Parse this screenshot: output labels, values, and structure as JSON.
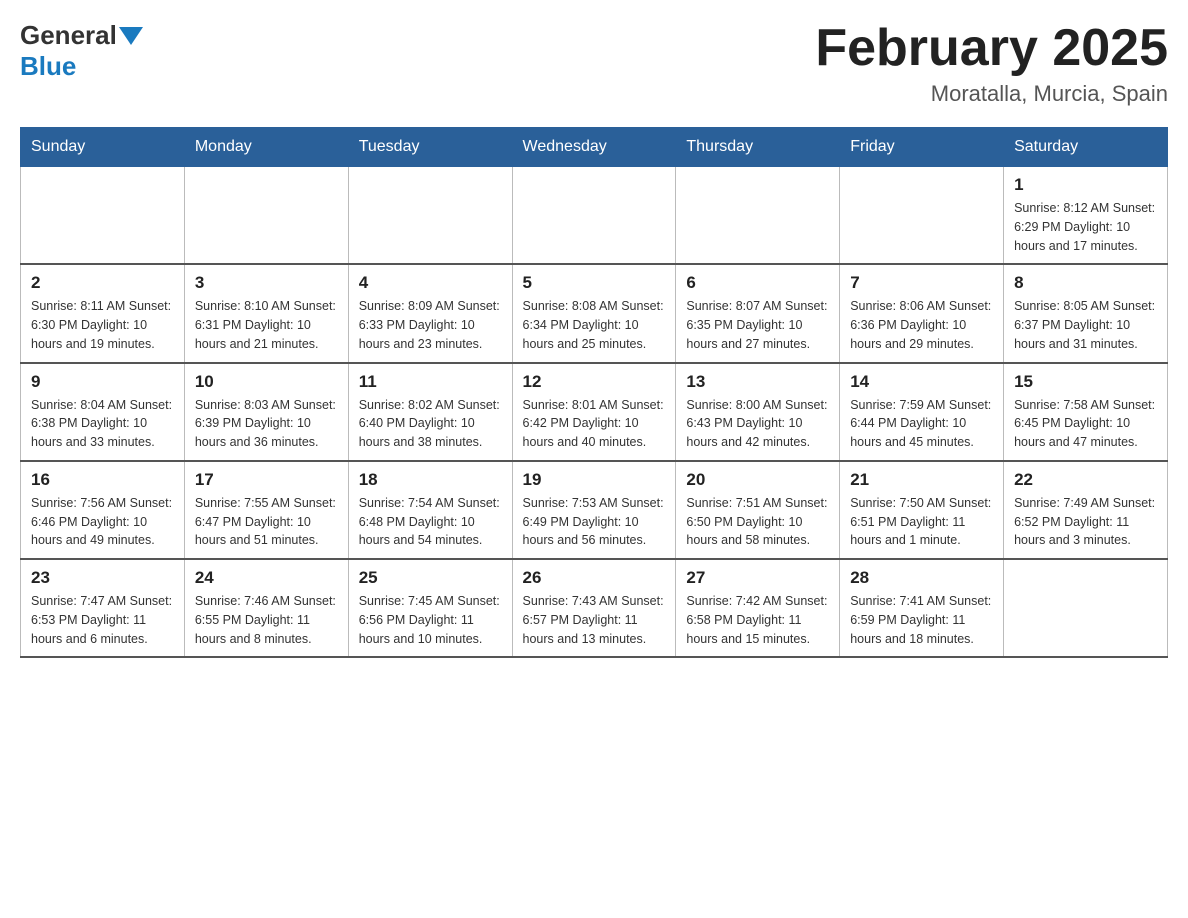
{
  "header": {
    "logo_general": "General",
    "logo_blue": "Blue",
    "month_title": "February 2025",
    "location": "Moratalla, Murcia, Spain"
  },
  "days_of_week": [
    "Sunday",
    "Monday",
    "Tuesday",
    "Wednesday",
    "Thursday",
    "Friday",
    "Saturday"
  ],
  "weeks": [
    [
      {
        "day": "",
        "info": ""
      },
      {
        "day": "",
        "info": ""
      },
      {
        "day": "",
        "info": ""
      },
      {
        "day": "",
        "info": ""
      },
      {
        "day": "",
        "info": ""
      },
      {
        "day": "",
        "info": ""
      },
      {
        "day": "1",
        "info": "Sunrise: 8:12 AM\nSunset: 6:29 PM\nDaylight: 10 hours and 17 minutes."
      }
    ],
    [
      {
        "day": "2",
        "info": "Sunrise: 8:11 AM\nSunset: 6:30 PM\nDaylight: 10 hours and 19 minutes."
      },
      {
        "day": "3",
        "info": "Sunrise: 8:10 AM\nSunset: 6:31 PM\nDaylight: 10 hours and 21 minutes."
      },
      {
        "day": "4",
        "info": "Sunrise: 8:09 AM\nSunset: 6:33 PM\nDaylight: 10 hours and 23 minutes."
      },
      {
        "day": "5",
        "info": "Sunrise: 8:08 AM\nSunset: 6:34 PM\nDaylight: 10 hours and 25 minutes."
      },
      {
        "day": "6",
        "info": "Sunrise: 8:07 AM\nSunset: 6:35 PM\nDaylight: 10 hours and 27 minutes."
      },
      {
        "day": "7",
        "info": "Sunrise: 8:06 AM\nSunset: 6:36 PM\nDaylight: 10 hours and 29 minutes."
      },
      {
        "day": "8",
        "info": "Sunrise: 8:05 AM\nSunset: 6:37 PM\nDaylight: 10 hours and 31 minutes."
      }
    ],
    [
      {
        "day": "9",
        "info": "Sunrise: 8:04 AM\nSunset: 6:38 PM\nDaylight: 10 hours and 33 minutes."
      },
      {
        "day": "10",
        "info": "Sunrise: 8:03 AM\nSunset: 6:39 PM\nDaylight: 10 hours and 36 minutes."
      },
      {
        "day": "11",
        "info": "Sunrise: 8:02 AM\nSunset: 6:40 PM\nDaylight: 10 hours and 38 minutes."
      },
      {
        "day": "12",
        "info": "Sunrise: 8:01 AM\nSunset: 6:42 PM\nDaylight: 10 hours and 40 minutes."
      },
      {
        "day": "13",
        "info": "Sunrise: 8:00 AM\nSunset: 6:43 PM\nDaylight: 10 hours and 42 minutes."
      },
      {
        "day": "14",
        "info": "Sunrise: 7:59 AM\nSunset: 6:44 PM\nDaylight: 10 hours and 45 minutes."
      },
      {
        "day": "15",
        "info": "Sunrise: 7:58 AM\nSunset: 6:45 PM\nDaylight: 10 hours and 47 minutes."
      }
    ],
    [
      {
        "day": "16",
        "info": "Sunrise: 7:56 AM\nSunset: 6:46 PM\nDaylight: 10 hours and 49 minutes."
      },
      {
        "day": "17",
        "info": "Sunrise: 7:55 AM\nSunset: 6:47 PM\nDaylight: 10 hours and 51 minutes."
      },
      {
        "day": "18",
        "info": "Sunrise: 7:54 AM\nSunset: 6:48 PM\nDaylight: 10 hours and 54 minutes."
      },
      {
        "day": "19",
        "info": "Sunrise: 7:53 AM\nSunset: 6:49 PM\nDaylight: 10 hours and 56 minutes."
      },
      {
        "day": "20",
        "info": "Sunrise: 7:51 AM\nSunset: 6:50 PM\nDaylight: 10 hours and 58 minutes."
      },
      {
        "day": "21",
        "info": "Sunrise: 7:50 AM\nSunset: 6:51 PM\nDaylight: 11 hours and 1 minute."
      },
      {
        "day": "22",
        "info": "Sunrise: 7:49 AM\nSunset: 6:52 PM\nDaylight: 11 hours and 3 minutes."
      }
    ],
    [
      {
        "day": "23",
        "info": "Sunrise: 7:47 AM\nSunset: 6:53 PM\nDaylight: 11 hours and 6 minutes."
      },
      {
        "day": "24",
        "info": "Sunrise: 7:46 AM\nSunset: 6:55 PM\nDaylight: 11 hours and 8 minutes."
      },
      {
        "day": "25",
        "info": "Sunrise: 7:45 AM\nSunset: 6:56 PM\nDaylight: 11 hours and 10 minutes."
      },
      {
        "day": "26",
        "info": "Sunrise: 7:43 AM\nSunset: 6:57 PM\nDaylight: 11 hours and 13 minutes."
      },
      {
        "day": "27",
        "info": "Sunrise: 7:42 AM\nSunset: 6:58 PM\nDaylight: 11 hours and 15 minutes."
      },
      {
        "day": "28",
        "info": "Sunrise: 7:41 AM\nSunset: 6:59 PM\nDaylight: 11 hours and 18 minutes."
      },
      {
        "day": "",
        "info": ""
      }
    ]
  ]
}
